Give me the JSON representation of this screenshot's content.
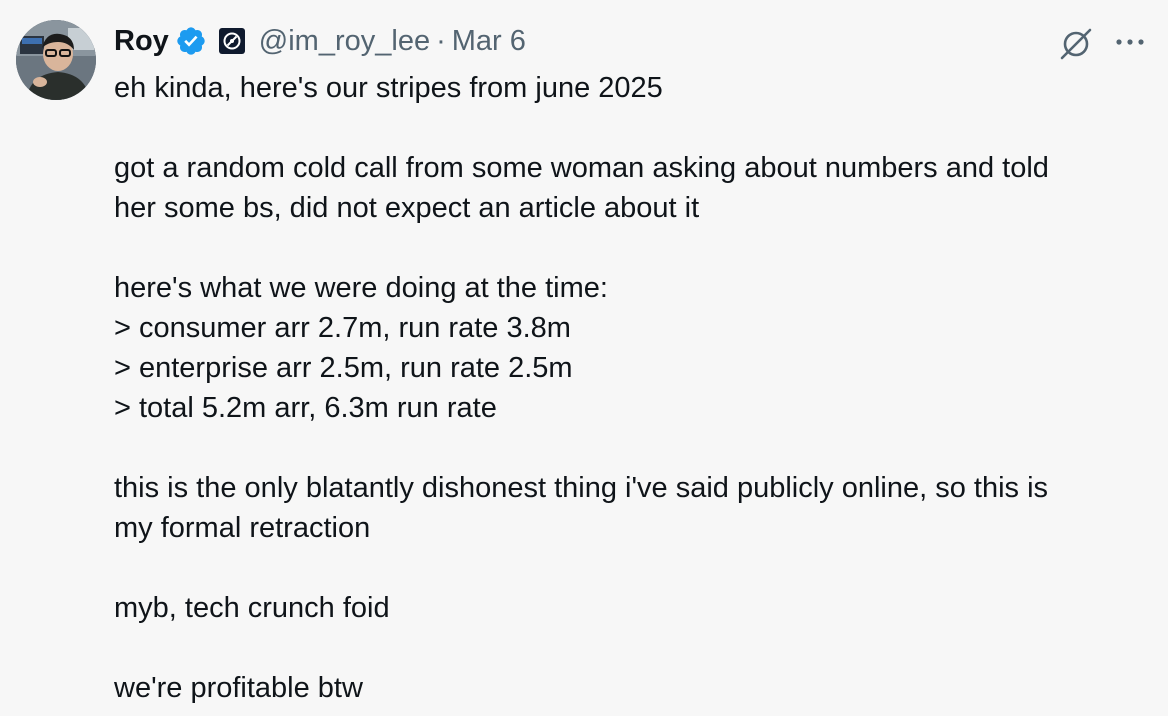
{
  "author": {
    "name": "Roy",
    "handle": "@im_roy_lee",
    "separator": "·",
    "date": "Mar 6",
    "verified_icon": "verified-badge-icon",
    "affiliate_icon": "affiliate-logo-icon",
    "avatar": "avatar-photo"
  },
  "actions": {
    "grok_icon": "grok-icon",
    "more_icon": "more-horizontal-icon"
  },
  "colors": {
    "background": "#f7f7f7",
    "text_primary": "#0f1419",
    "text_secondary": "#536471",
    "verified_blue": "#1d9bf0"
  },
  "tweet": {
    "lines": [
      "eh kinda, here's our stripes from june 2025",
      "",
      "got a random cold call from some woman asking about numbers and told",
      "her some bs, did not expect an article about it",
      "",
      "here's what we were doing at the time:",
      "> consumer arr 2.7m, run rate 3.8m",
      "> enterprise arr 2.5m, run rate 2.5m",
      "> total 5.2m arr, 6.3m run rate",
      "",
      "this is the only blatantly dishonest thing i've said publicly online, so this is",
      "my formal retraction",
      "",
      "myb, tech crunch foid",
      "",
      "we're profitable btw"
    ]
  }
}
